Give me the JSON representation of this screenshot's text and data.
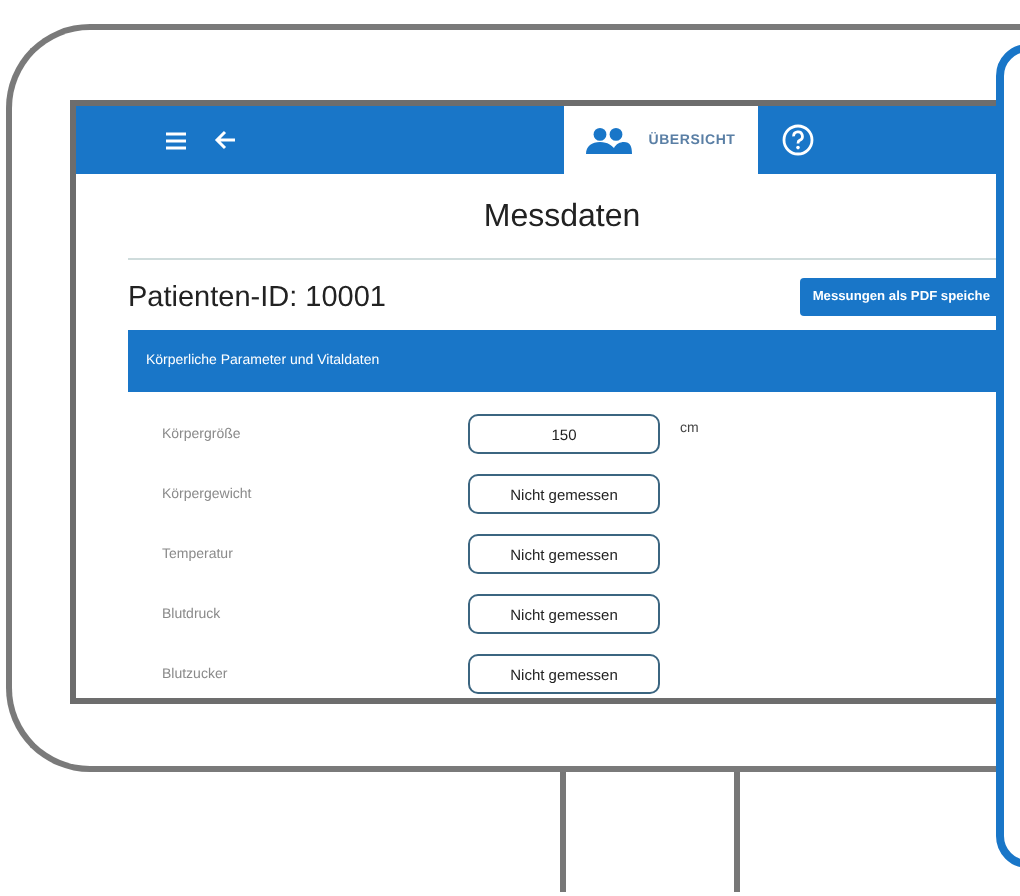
{
  "toolbar": {
    "tabs": [
      {
        "label": "ÜBERSICHT",
        "selected": true
      }
    ]
  },
  "title": "Messdaten",
  "patient_id": "Patienten-ID: 10001",
  "pdf_button": "Messungen als PDF speiche",
  "section": {
    "title": "Körperliche Parameter und Vitaldaten",
    "rows": [
      {
        "label": "Körpergröße",
        "value": "150",
        "unit": "cm"
      },
      {
        "label": "Körpergewicht",
        "value": "Nicht gemessen"
      },
      {
        "label": "Temperatur",
        "value": "Nicht gemessen"
      },
      {
        "label": "Blutdruck",
        "value": "Nicht gemessen"
      },
      {
        "label": "Blutzucker",
        "value": "Nicht gemessen"
      }
    ]
  }
}
